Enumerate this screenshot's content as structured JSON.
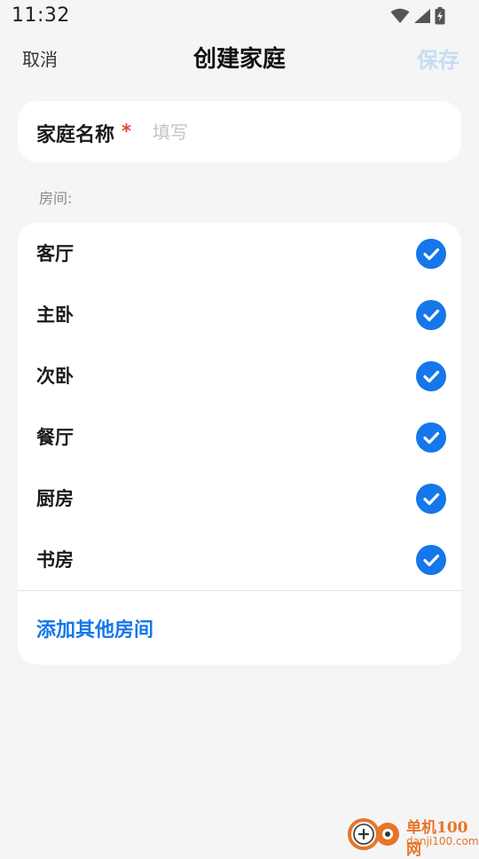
{
  "status_bar": {
    "time": "11:32"
  },
  "nav": {
    "cancel_label": "取消",
    "title": "创建家庭",
    "save_label": "保存"
  },
  "family_name": {
    "label": "家庭名称",
    "required_mark": "*",
    "placeholder": "填写",
    "value": ""
  },
  "rooms": {
    "section_label": "房间:",
    "items": [
      {
        "name": "客厅",
        "checked": true
      },
      {
        "name": "主卧",
        "checked": true
      },
      {
        "name": "次卧",
        "checked": true
      },
      {
        "name": "餐厅",
        "checked": true
      },
      {
        "name": "厨房",
        "checked": true
      },
      {
        "name": "书房",
        "checked": true
      }
    ],
    "add_label": "添加其他房间"
  },
  "watermark": {
    "title": "单机100网",
    "url": "danji100.com"
  },
  "colors": {
    "accent": "#1577ea",
    "save_disabled": "#c6dcf5",
    "required": "#e8443a",
    "background": "#f5f5f5",
    "card": "#ffffff",
    "watermark": "#e8742a"
  },
  "icons": {
    "status_wifi": "wifi-icon",
    "status_signal": "signal-icon",
    "status_battery": "battery-charging-icon",
    "room_check": "check-circle-icon"
  }
}
